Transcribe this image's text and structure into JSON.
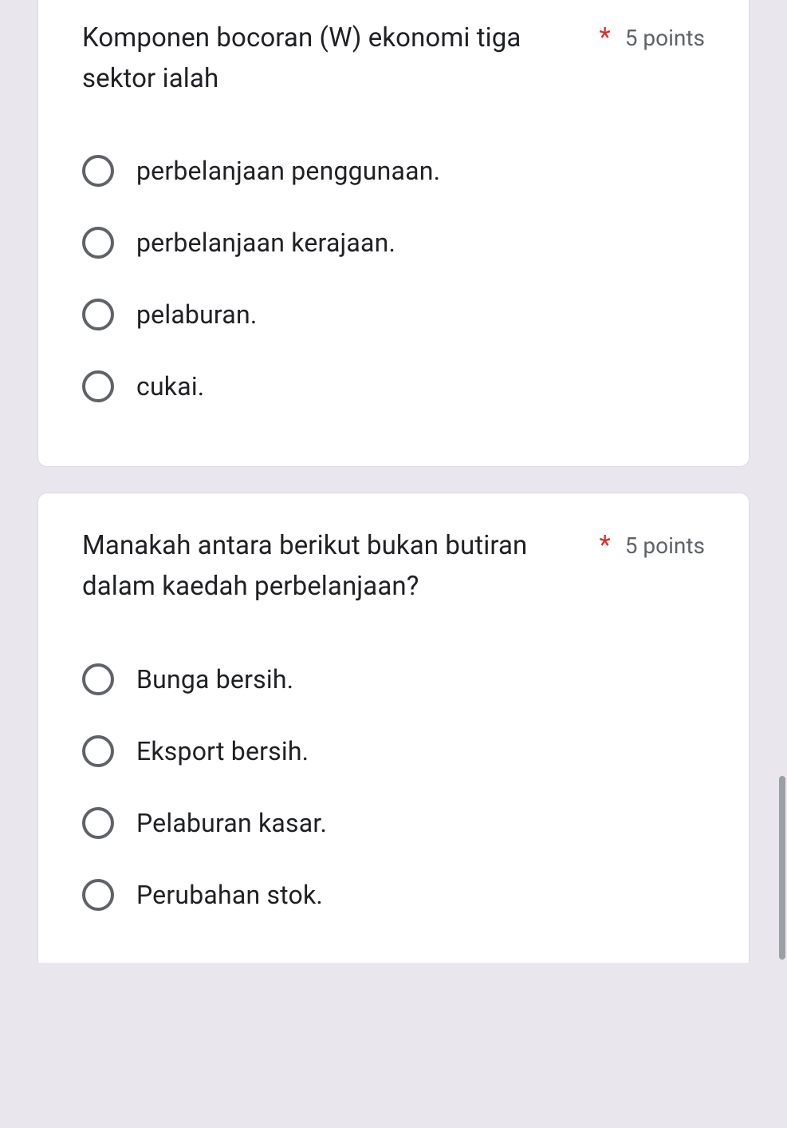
{
  "questions": [
    {
      "title": "Komponen bocoran (W) ekonomi tiga sektor ialah",
      "required": "*",
      "points": "5 points",
      "options": [
        "perbelanjaan penggunaan.",
        "perbelanjaan kerajaan.",
        "pelaburan.",
        "cukai."
      ]
    },
    {
      "title": "Manakah antara berikut bukan butiran dalam kaedah perbelanjaan?",
      "required": "*",
      "points": "5 points",
      "options": [
        "Bunga bersih.",
        "Eksport bersih.",
        "Pelaburan kasar.",
        "Perubahan stok."
      ]
    }
  ]
}
